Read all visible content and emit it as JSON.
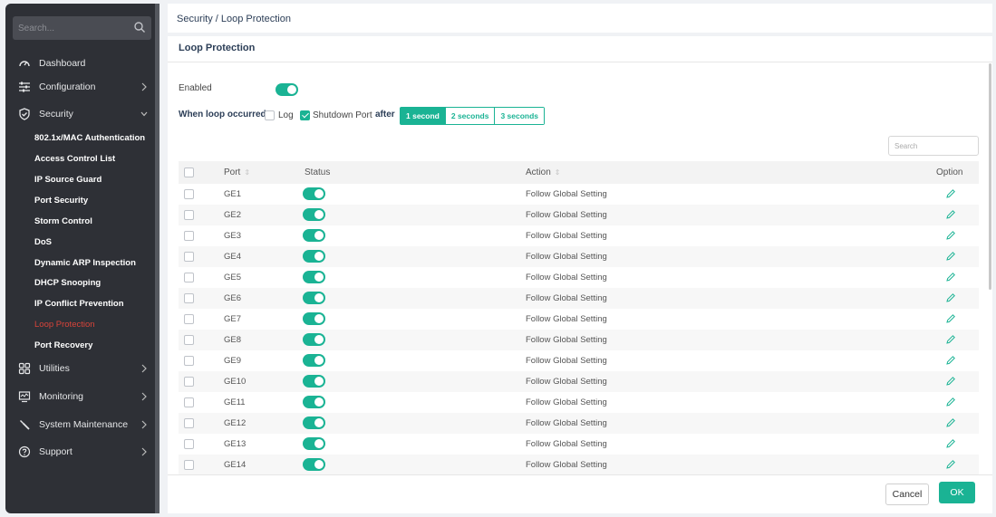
{
  "colors": {
    "accent": "#1ab394",
    "active_nav": "#d9443a",
    "sidebar_bg": "#2e3036"
  },
  "sidebar": {
    "search_placeholder": "Search...",
    "items": [
      {
        "label": "Dashboard",
        "icon": "dashboard-icon"
      },
      {
        "label": "Configuration",
        "icon": "sliders-icon"
      },
      {
        "label": "Security",
        "icon": "shield-icon"
      },
      {
        "label": "Utilities",
        "icon": "grid-icon"
      },
      {
        "label": "Monitoring",
        "icon": "monitor-icon"
      },
      {
        "label": "System Maintenance",
        "icon": "wrench-icon"
      },
      {
        "label": "Support",
        "icon": "help-icon"
      }
    ],
    "security_subitems": [
      "802.1x/MAC Authentication",
      "Access Control List",
      "IP Source Guard",
      "Port Security",
      "Storm Control",
      "DoS",
      "Dynamic ARP Inspection",
      "DHCP Snooping",
      "IP Conflict Prevention",
      "Loop Protection",
      "Port Recovery"
    ],
    "active_subitem": "Loop Protection"
  },
  "breadcrumb": "Security / Loop Protection",
  "panel": {
    "title": "Loop Protection",
    "enabled_label": "Enabled",
    "enabled": true,
    "when_loop_label": "When loop occurred,",
    "log_label": "Log",
    "log_checked": false,
    "shutdown_label": "Shutdown Port",
    "shutdown_checked": true,
    "after_label": "after",
    "durations": [
      "1 second",
      "2 seconds",
      "3 seconds"
    ],
    "selected_duration": "1 second",
    "search_placeholder": "Search"
  },
  "table": {
    "headers": {
      "port": "Port",
      "status": "Status",
      "action": "Action",
      "option": "Option"
    },
    "rows": [
      {
        "port": "GE1",
        "status": true,
        "action": "Follow Global Setting"
      },
      {
        "port": "GE2",
        "status": true,
        "action": "Follow Global Setting"
      },
      {
        "port": "GE3",
        "status": true,
        "action": "Follow Global Setting"
      },
      {
        "port": "GE4",
        "status": true,
        "action": "Follow Global Setting"
      },
      {
        "port": "GE5",
        "status": true,
        "action": "Follow Global Setting"
      },
      {
        "port": "GE6",
        "status": true,
        "action": "Follow Global Setting"
      },
      {
        "port": "GE7",
        "status": true,
        "action": "Follow Global Setting"
      },
      {
        "port": "GE8",
        "status": true,
        "action": "Follow Global Setting"
      },
      {
        "port": "GE9",
        "status": true,
        "action": "Follow Global Setting"
      },
      {
        "port": "GE10",
        "status": true,
        "action": "Follow Global Setting"
      },
      {
        "port": "GE11",
        "status": true,
        "action": "Follow Global Setting"
      },
      {
        "port": "GE12",
        "status": true,
        "action": "Follow Global Setting"
      },
      {
        "port": "GE13",
        "status": true,
        "action": "Follow Global Setting"
      },
      {
        "port": "GE14",
        "status": true,
        "action": "Follow Global Setting"
      }
    ]
  },
  "footer": {
    "cancel_label": "Cancel",
    "ok_label": "OK"
  }
}
